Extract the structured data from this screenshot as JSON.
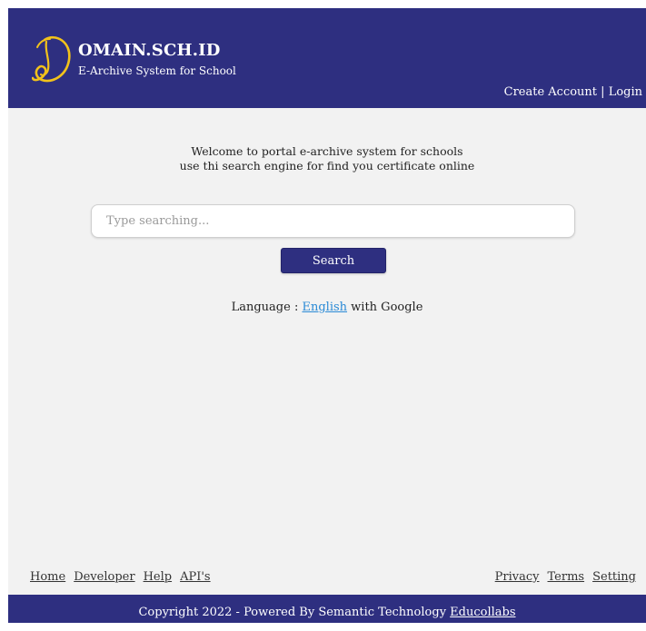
{
  "header": {
    "brand_name": "OMAIN.SCH.ID",
    "tagline": "E-Archive System for School",
    "create_account": "Create Account",
    "separator": " | ",
    "login": "Login",
    "logo_icon": "script-d-logo-icon",
    "logo_color": "#f2c21b",
    "bg_color": "#2e2f80"
  },
  "main": {
    "welcome_line1": "Welcome to portal e-archive system for schools",
    "welcome_line2": "use thi search engine for find you certificate online",
    "search_placeholder": "Type searching...",
    "search_value": "",
    "search_button": "Search",
    "language_prefix": "Language : ",
    "language_link": "English",
    "language_suffix": " with Google",
    "link_color": "#2a8ad6"
  },
  "footer": {
    "left_links": [
      "Home",
      "Developer",
      "Help",
      "API's"
    ],
    "right_links": [
      "Privacy",
      "Terms",
      "Setting"
    ],
    "copyright": "Copyright 2022 - Powered By Semantic Technology ",
    "copyright_link": "Educollabs"
  }
}
